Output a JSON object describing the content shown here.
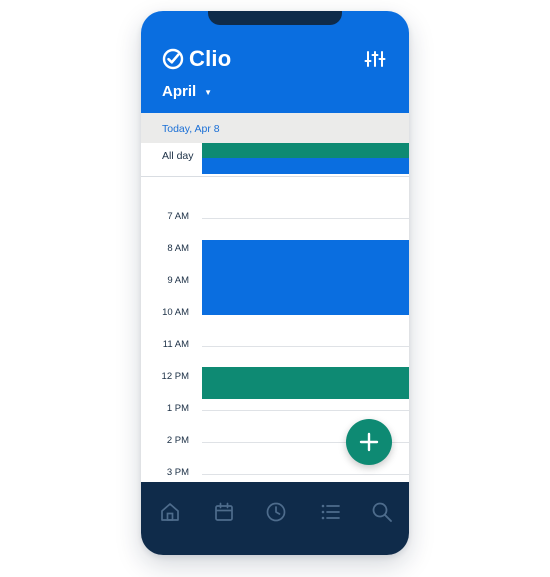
{
  "app": {
    "name": "Clio"
  },
  "header": {
    "month": "April"
  },
  "today_bar": {
    "label": "Today, Apr 8"
  },
  "all_day": {
    "label": "All day"
  },
  "hours": [
    "7 AM",
    "8 AM",
    "9 AM",
    "10 AM",
    "11 AM",
    "12 PM",
    "1 PM",
    "2 PM",
    "3 PM"
  ],
  "colors": {
    "brand_blue": "#0a6ee0",
    "event_green": "#0e8a73",
    "tabbar_navy": "#0f2b4a"
  },
  "tabbar": {
    "items": [
      {
        "icon": "home-icon"
      },
      {
        "icon": "calendar-icon"
      },
      {
        "icon": "clock-icon"
      },
      {
        "icon": "list-icon"
      },
      {
        "icon": "search-icon"
      }
    ]
  },
  "fab": {
    "icon": "plus-icon"
  }
}
